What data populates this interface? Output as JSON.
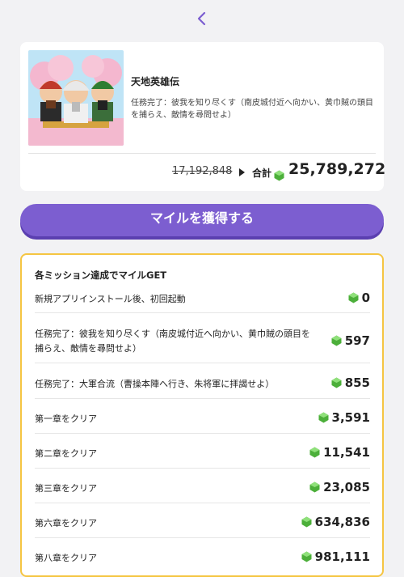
{
  "card": {
    "title": "天地英雄伝",
    "subtitle": "任務完了：彼我を知り尽くす（南皮城付近へ向かい、黄巾賊の頭目を捕らえ、敵情を尋問せよ）",
    "old_total": "17,192,848",
    "total_label": "合計",
    "total_value": "25,789,272"
  },
  "cta": {
    "label": "マイルを獲得する"
  },
  "missions": {
    "title": "各ミッション達成でマイルGET",
    "items": [
      {
        "label": "新規アプリインストール後、初回起動",
        "value": "0"
      },
      {
        "label": "任務完了：彼我を知り尽くす（南皮城付近へ向かい、黄巾賊の頭目を捕らえ、敵情を尋問せよ）",
        "value": "597"
      },
      {
        "label": "任務完了：大軍合流（曹操本陣へ行き、朱将軍に拝謁せよ）",
        "value": "855"
      },
      {
        "label": "第一章をクリア",
        "value": "3,591"
      },
      {
        "label": "第二章をクリア",
        "value": "11,541"
      },
      {
        "label": "第三章をクリア",
        "value": "23,085"
      },
      {
        "label": "第六章をクリア",
        "value": "634,836"
      },
      {
        "label": "第八章をクリア",
        "value": "981,111"
      }
    ]
  },
  "colors": {
    "accent": "#7c5ed0",
    "highlight_border": "#f5c542",
    "gem": "#5cc24a"
  },
  "icons": {
    "back": "chevron-left-icon",
    "gem": "green-gem-icon"
  }
}
